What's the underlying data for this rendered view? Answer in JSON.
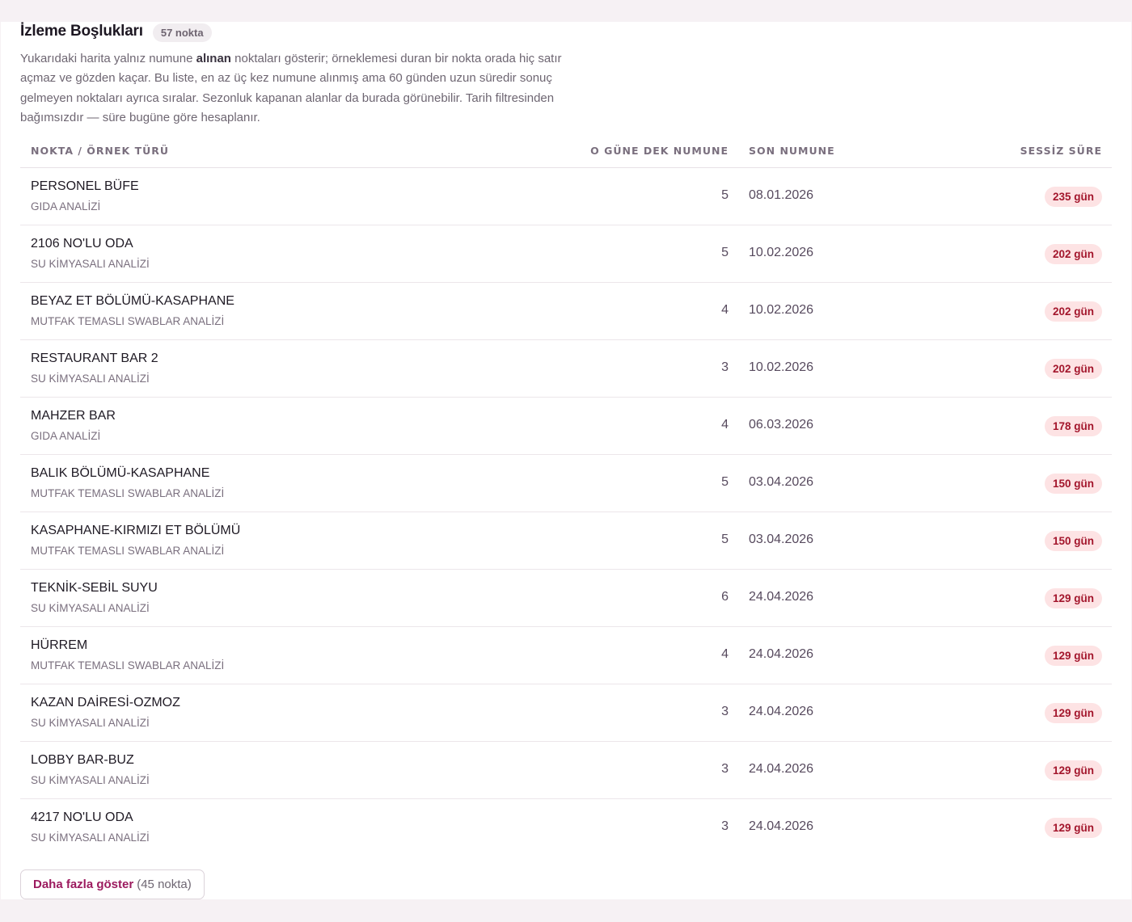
{
  "section": {
    "title": "İzleme Boşlukları",
    "count_badge": "57 nokta",
    "description": {
      "part1": "Yukarıdaki harita yalnız numune ",
      "bold": "alınan",
      "part2": " noktaları gösterir; örneklemesi duran bir nokta orada hiç satır açmaz ve gözden kaçar. Bu liste, en az üç kez numune alınmış ama 60 günden uzun süredir sonuç gelmeyen noktaları ayrıca sıralar. Sezonluk kapanan alanlar da burada görünebilir. Tarih filtresinden bağımsızdır — süre bugüne göre hesaplanır."
    }
  },
  "table": {
    "headers": {
      "point": "NOKTA / ÖRNEK TÜRÜ",
      "count": "O GÜNE DEK NUMUNE",
      "last": "SON NUMUNE",
      "silent": "SESSİZ SÜRE"
    },
    "rows": [
      {
        "name": "PERSONEL BÜFE",
        "type": "GIDA ANALİZİ",
        "count": "5",
        "last": "08.01.2026",
        "silent": "235 gün"
      },
      {
        "name": "2106 NO'LU ODA",
        "type": "SU KİMYASALI ANALİZİ",
        "count": "5",
        "last": "10.02.2026",
        "silent": "202 gün"
      },
      {
        "name": "BEYAZ ET BÖLÜMÜ-KASAPHANE",
        "type": "MUTFAK TEMASLI SWABLAR ANALİZİ",
        "count": "4",
        "last": "10.02.2026",
        "silent": "202 gün"
      },
      {
        "name": "RESTAURANT BAR 2",
        "type": "SU KİMYASALI ANALİZİ",
        "count": "3",
        "last": "10.02.2026",
        "silent": "202 gün"
      },
      {
        "name": "MAHZER BAR",
        "type": "GIDA ANALİZİ",
        "count": "4",
        "last": "06.03.2026",
        "silent": "178 gün"
      },
      {
        "name": "BALIK BÖLÜMÜ-KASAPHANE",
        "type": "MUTFAK TEMASLI SWABLAR ANALİZİ",
        "count": "5",
        "last": "03.04.2026",
        "silent": "150 gün"
      },
      {
        "name": "KASAPHANE-KIRMIZI ET BÖLÜMÜ",
        "type": "MUTFAK TEMASLI SWABLAR ANALİZİ",
        "count": "5",
        "last": "03.04.2026",
        "silent": "150 gün"
      },
      {
        "name": "TEKNİK-SEBİL SUYU",
        "type": "SU KİMYASALI ANALİZİ",
        "count": "6",
        "last": "24.04.2026",
        "silent": "129 gün"
      },
      {
        "name": "HÜRREM",
        "type": "MUTFAK TEMASLI SWABLAR ANALİZİ",
        "count": "4",
        "last": "24.04.2026",
        "silent": "129 gün"
      },
      {
        "name": "KAZAN DAİRESİ-OZMOZ",
        "type": "SU KİMYASALI ANALİZİ",
        "count": "3",
        "last": "24.04.2026",
        "silent": "129 gün"
      },
      {
        "name": "LOBBY BAR-BUZ",
        "type": "SU KİMYASALI ANALİZİ",
        "count": "3",
        "last": "24.04.2026",
        "silent": "129 gün"
      },
      {
        "name": "4217 NO'LU ODA",
        "type": "SU KİMYASALI ANALİZİ",
        "count": "3",
        "last": "24.04.2026",
        "silent": "129 gün"
      }
    ]
  },
  "more_button": {
    "label": "Daha fazla göster",
    "count": "(45 nokta)"
  },
  "colors": {
    "accent": "#9c1b5f",
    "silent_badge_bg": "#fde3e4",
    "silent_badge_text": "#a3162c",
    "page_bg": "#f6f1f4"
  }
}
